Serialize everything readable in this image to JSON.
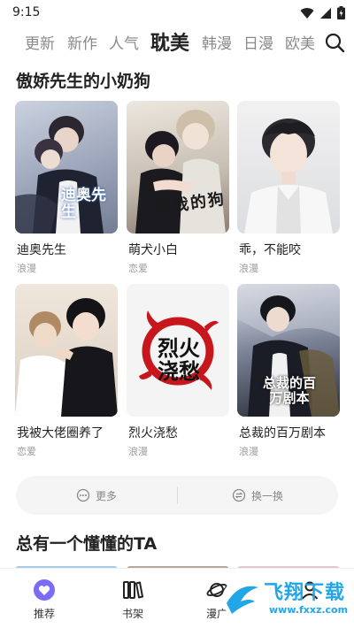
{
  "status_bar": {
    "time": "9:15"
  },
  "tabs": [
    {
      "label": "更新"
    },
    {
      "label": "新作"
    },
    {
      "label": "人气"
    },
    {
      "label": "耽美"
    },
    {
      "label": "韩漫"
    },
    {
      "label": "日漫"
    },
    {
      "label": "欧美"
    }
  ],
  "active_tab": "耽美",
  "sections": [
    {
      "title": "傲娇先生的小奶狗"
    },
    {
      "title": "总有一个懂懂的TA"
    }
  ],
  "comics": [
    {
      "title": "迪奥先生",
      "tag": "浪漫",
      "cover_text": "迪奥先生"
    },
    {
      "title": "萌犬小白",
      "tag": "恋爱",
      "cover_text": "做我的狗"
    },
    {
      "title": "乖，不能咬",
      "tag": "浪漫",
      "cover_text": ""
    },
    {
      "title": "我被大佬圈养了",
      "tag": "恋爱",
      "cover_text": ""
    },
    {
      "title": "烈火浇愁",
      "tag": "浪漫",
      "cover_text": "烈火浇愁"
    },
    {
      "title": "总裁的百万剧本",
      "tag": "浪漫",
      "cover_text": "总裁的百万剧本"
    }
  ],
  "actions": {
    "more": "更多",
    "refresh": "换一换"
  },
  "bottom_nav": [
    {
      "label": "推荐",
      "icon": "heart-icon",
      "active": true
    },
    {
      "label": "书架",
      "icon": "bookshelf-icon",
      "active": false
    },
    {
      "label": "漫广",
      "icon": "planet-icon",
      "active": false
    },
    {
      "label": "",
      "icon": "profile-icon",
      "active": false
    }
  ],
  "watermark": {
    "title": "飞翔下载",
    "url": "www.fxxz.com"
  },
  "colors": {
    "accent": "#7b6cf6",
    "watermark": "#21a6e8"
  }
}
